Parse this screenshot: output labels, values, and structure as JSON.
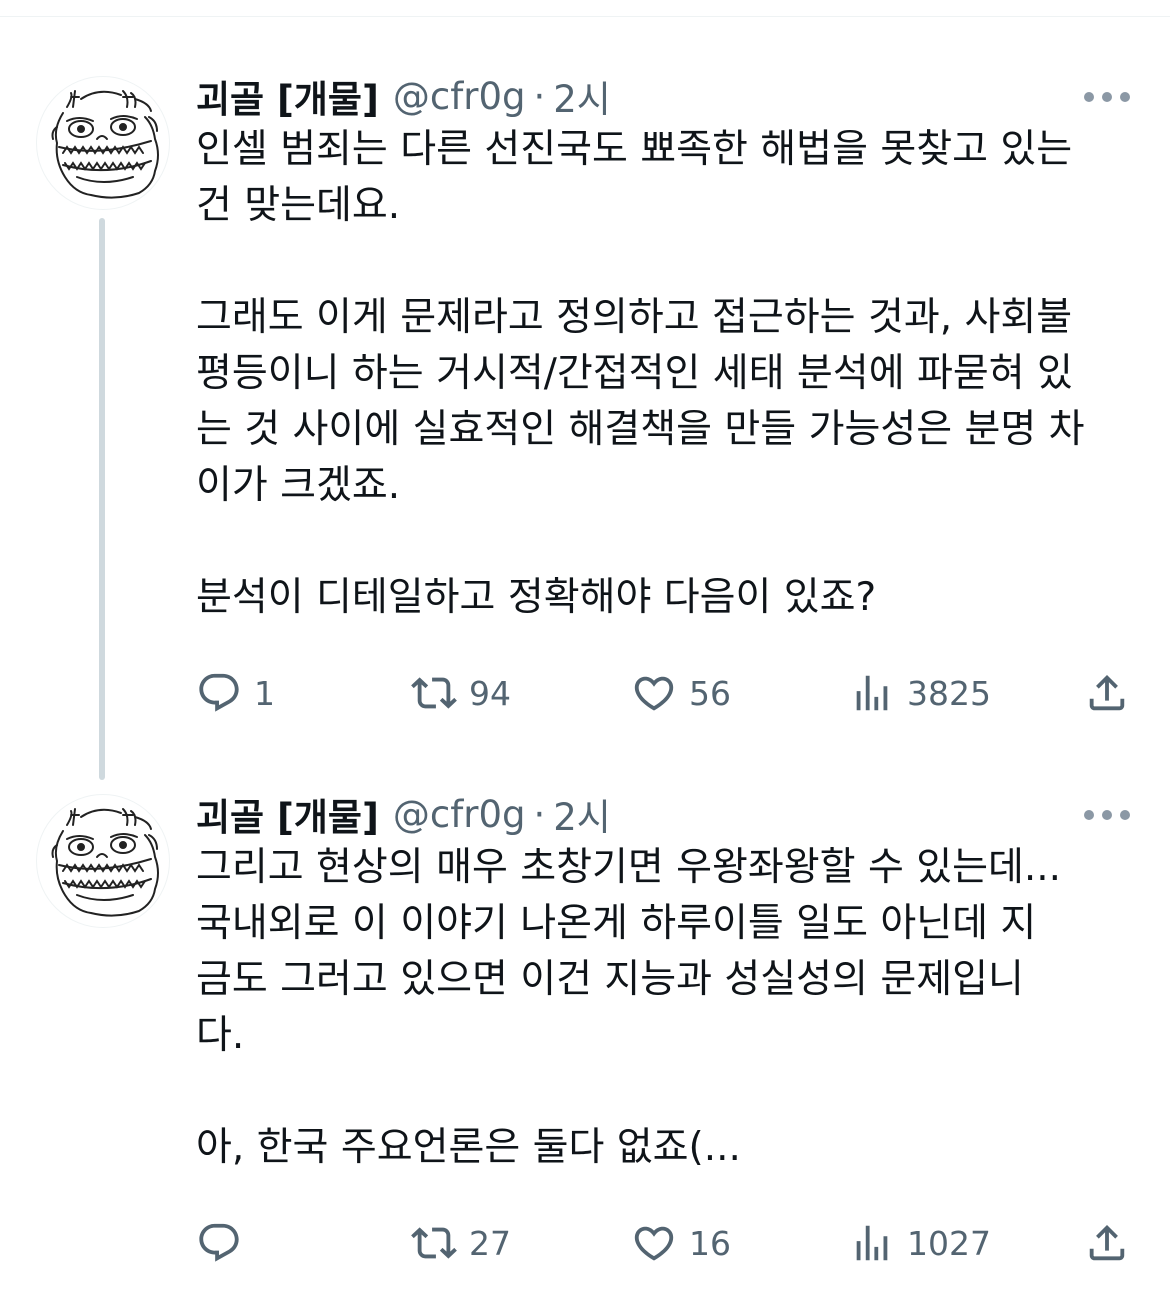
{
  "tweets": [
    {
      "display_name": "괴골 [개물]",
      "handle": "@cfr0g",
      "separator": "·",
      "time": "2시",
      "text": "인셀 범죄는 다른 선진국도 뾰족한 해법을 못찾고 있는\n건 맞는데요.\n\n그래도 이게 문제라고 정의하고 접근하는 것과, 사회불\n평등이니 하는 거시적/간접적인 세태 분석에 파묻혀 있\n는 것 사이에 실효적인 해결책을 만들 가능성은 분명 차\n이가 크겠죠.\n\n분석이 디테일하고 정확해야 다음이 있죠?",
      "replies": "1",
      "retweets": "94",
      "likes": "56",
      "views": "3825"
    },
    {
      "display_name": "괴골 [개물]",
      "handle": "@cfr0g",
      "separator": "·",
      "time": "2시",
      "text": "그리고 현상의 매우 초창기면 우왕좌왕할 수 있는데...\n국내외로 이 이야기 나온게 하루이틀 일도 아닌데 지\n금도 그러고 있으면 이건 지능과 성실성의 문제입니\n다.\n\n아, 한국 주요언론은 둘다 없죠(...",
      "replies": "",
      "retweets": "27",
      "likes": "16",
      "views": "1027"
    }
  ],
  "icons": {
    "reply": "reply-bubble-icon",
    "retweet": "retweet-icon",
    "like": "heart-icon",
    "views": "views-bar-chart-icon",
    "share": "share-upload-icon",
    "more": "more-dots-icon",
    "avatar": "monster-doodle-avatar"
  },
  "colors": {
    "text": "#0f1419",
    "secondary": "#536471",
    "thread_line": "#cfd9de",
    "background": "#ffffff"
  }
}
